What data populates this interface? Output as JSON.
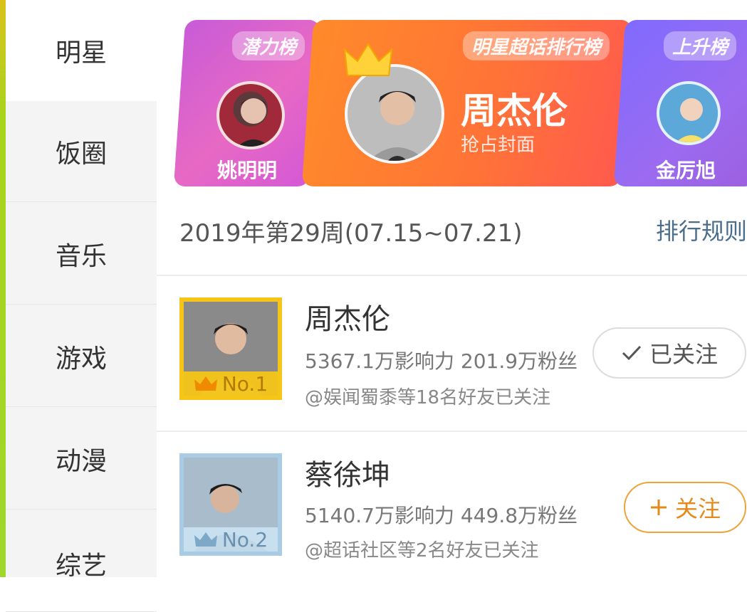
{
  "sidebar": {
    "items": [
      {
        "label": "明星"
      },
      {
        "label": "饭圈"
      },
      {
        "label": "音乐"
      },
      {
        "label": "游戏"
      },
      {
        "label": "动漫"
      },
      {
        "label": "综艺"
      }
    ],
    "active_index": 0
  },
  "banner": {
    "left": {
      "tag": "潜力榜",
      "name": "姚明明"
    },
    "center": {
      "tag": "明星超话排行榜",
      "name": "周杰伦",
      "subtitle": "抢占封面"
    },
    "right": {
      "tag": "上升榜",
      "name": "金厉旭"
    }
  },
  "week": {
    "title": "2019年第29周(07.15~07.21)",
    "rule_link": "排行规则"
  },
  "rankings": [
    {
      "name": "周杰伦",
      "stats": "5367.1万影响力 201.9万粉丝",
      "friends": "@娱闻蜀黍等18名好友已关注",
      "badge": "No.1",
      "follow_label": "已关注",
      "follow_icon": "checkmark-icon"
    },
    {
      "name": "蔡徐坤",
      "stats": "5140.7万影响力 449.8万粉丝",
      "friends": "@超话社区等2名好友已关注",
      "badge": "No.2",
      "follow_label": "关注",
      "follow_icon": "plus-icon"
    }
  ],
  "colors": {
    "gold": "#f5c518",
    "silver_blue": "#a9cbe3",
    "follow_orange": "#f0a33a",
    "link_blue": "#4a6d8c"
  }
}
